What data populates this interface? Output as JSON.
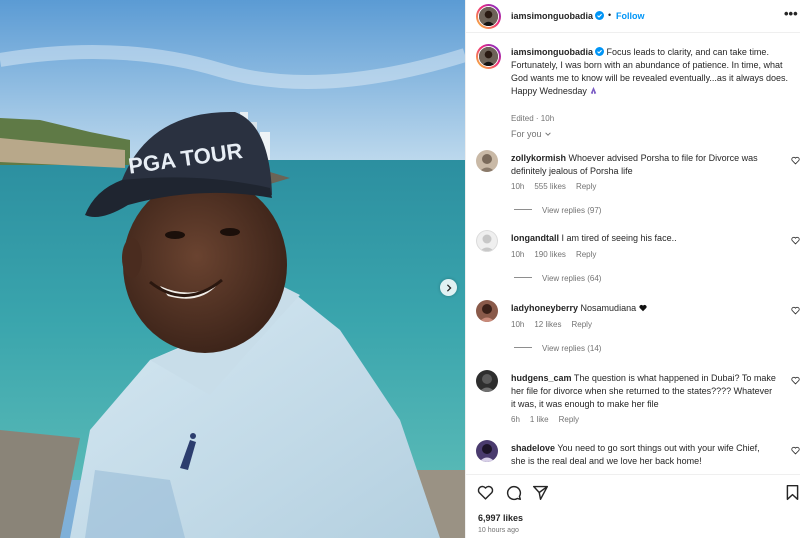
{
  "post": {
    "username": "iamsimonguobadia",
    "follow_label": "Follow",
    "dot": "•",
    "more": "•••",
    "caption": "Focus leads to clarity, and can take time. Fortunately, I was born with an abundance of patience. In time, what God wants me to know will be revealed eventually...as it always does. Happy Wednesday",
    "caption_meta": "Edited · 10h",
    "for_you": "For you",
    "likes": "6,997 likes",
    "time_ago": "10 hours ago",
    "photo_cap_text": "PGA TOUR"
  },
  "comments": [
    {
      "username": "zollykormish",
      "text": "Whoever advised Porsha to file for Divorce was definitely jealous of Porsha life",
      "time": "10h",
      "likes": "555 likes",
      "reply": "Reply",
      "view_replies": "View replies (97)",
      "avatar_color": "#c9b9a6"
    },
    {
      "username": "longandtall",
      "text": "I am tired of seeing his face..",
      "time": "10h",
      "likes": "190 likes",
      "reply": "Reply",
      "view_replies": "View replies (64)",
      "avatar_color": "#dbdbdb"
    },
    {
      "username": "ladyhoneyberry",
      "text": "Nosamudiana",
      "time": "10h",
      "likes": "12 likes",
      "reply": "Reply",
      "view_replies": "View replies (14)",
      "avatar_color": "#8a5a4a"
    },
    {
      "username": "hudgens_cam",
      "text": "The question is what happened in Dubai? To make her file for divorce when she returned to the states???? Whatever it was, it was enough to make her file",
      "time": "6h",
      "likes": "1 like",
      "reply": "Reply",
      "avatar_color": "#2e2e2e"
    },
    {
      "username": "shadelove",
      "text": "You need to go sort things out with your wife Chief, she is the real deal and we love her back home!",
      "avatar_color": "#4a3b6e"
    }
  ],
  "icons": {
    "verified": "verified-badge-icon",
    "prayer_emoji": "praying-hands-emoji",
    "heart_emoji": "black-heart-emoji",
    "like": "heart-icon",
    "comment": "comment-icon",
    "share": "send-icon",
    "save": "bookmark-icon",
    "next": "chevron-right-icon"
  },
  "colors": {
    "link_blue": "#0095f6",
    "verified_blue": "#0095f6",
    "secondary_text": "#737373"
  }
}
